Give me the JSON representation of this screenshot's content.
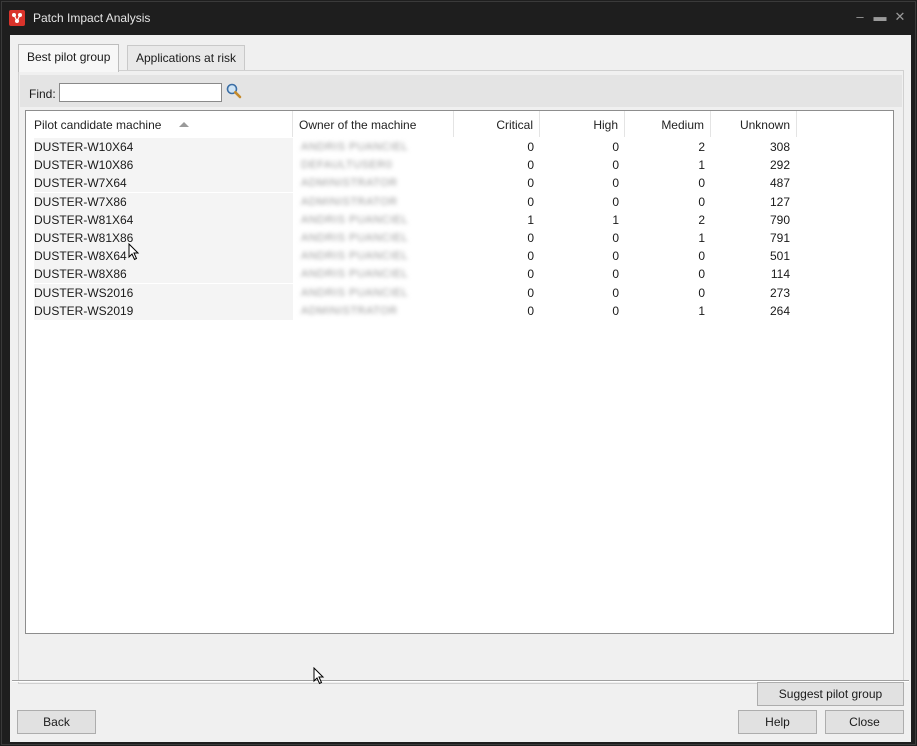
{
  "window": {
    "title": "Patch Impact Analysis"
  },
  "tabs": [
    {
      "label": "Best pilot group"
    },
    {
      "label": "Applications at risk"
    }
  ],
  "find": {
    "label": "Find:",
    "value": ""
  },
  "grid": {
    "columns": [
      "Pilot candidate machine",
      "Owner of the machine",
      "Critical",
      "High",
      "Medium",
      "Unknown"
    ],
    "rows": [
      {
        "machine": "DUSTER-W10X64",
        "owner": "ANDRIS PUANCIEL",
        "critical": "0",
        "high": "0",
        "medium": "2",
        "unknown": "308"
      },
      {
        "machine": "DUSTER-W10X86",
        "owner": "DEFAULTUSER0",
        "critical": "0",
        "high": "0",
        "medium": "1",
        "unknown": "292"
      },
      {
        "machine": "DUSTER-W7X64",
        "owner": "ADMINISTRATOR",
        "critical": "0",
        "high": "0",
        "medium": "0",
        "unknown": "487"
      },
      {
        "machine": "DUSTER-W7X86",
        "owner": "ADMINISTRATOR",
        "critical": "0",
        "high": "0",
        "medium": "0",
        "unknown": "127"
      },
      {
        "machine": "DUSTER-W81X64",
        "owner": "ANDRIS PUANCIEL",
        "critical": "1",
        "high": "1",
        "medium": "2",
        "unknown": "790"
      },
      {
        "machine": "DUSTER-W81X86",
        "owner": "ANDRIS PUANCIEL",
        "critical": "0",
        "high": "0",
        "medium": "1",
        "unknown": "791"
      },
      {
        "machine": "DUSTER-W8X64",
        "owner": "ANDRIS PUANCIEL",
        "critical": "0",
        "high": "0",
        "medium": "0",
        "unknown": "501"
      },
      {
        "machine": "DUSTER-W8X86",
        "owner": "ANDRIS PUANCIEL",
        "critical": "0",
        "high": "0",
        "medium": "0",
        "unknown": "114"
      },
      {
        "machine": "DUSTER-WS2016",
        "owner": "ANDRIS PUANCIEL",
        "critical": "0",
        "high": "0",
        "medium": "0",
        "unknown": "273"
      },
      {
        "machine": "DUSTER-WS2019",
        "owner": "ADMINISTRATOR",
        "critical": "0",
        "high": "0",
        "medium": "1",
        "unknown": "264"
      }
    ],
    "sorted_by": "Pilot candidate machine",
    "sort_direction": "ascending"
  },
  "buttons": {
    "suggest": "Suggest pilot group",
    "back": "Back",
    "help": "Help",
    "close": "Close"
  },
  "title_controls": {
    "minimize": "‒",
    "maximize": "▬",
    "close": "✕"
  },
  "colors": {
    "title_bg": "#1e1e1e",
    "client_bg": "#f0f0f0",
    "app_icon": "#d9332b"
  }
}
